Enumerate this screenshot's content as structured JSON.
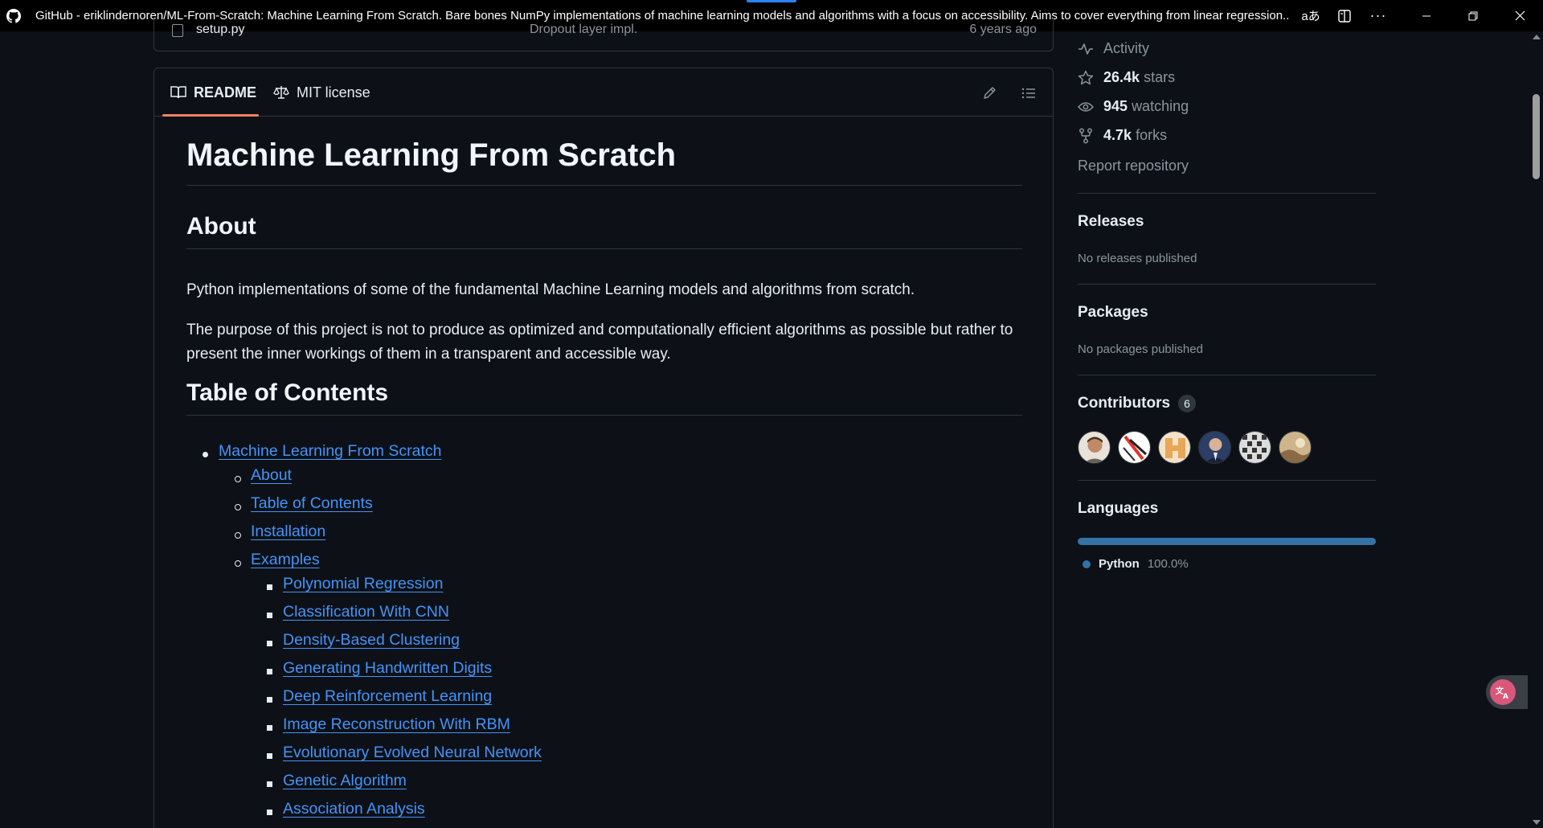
{
  "window": {
    "title": "GitHub - eriklindernoren/ML-From-Scratch: Machine Learning From Scratch. Bare bones NumPy implementations of machine learning models and algorithms with a focus on accessibility. Aims to cover everything from linear regression...",
    "read_aloud_glyph": "aあ"
  },
  "file_row": {
    "name": "setup.py",
    "message": "Dropout layer impl.",
    "time": "6 years ago"
  },
  "readme_tabs": {
    "readme": "README",
    "license": "MIT license"
  },
  "readme": {
    "title": "Machine Learning From Scratch",
    "about_heading": "About",
    "about_p1": "Python implementations of some of the fundamental Machine Learning models and algorithms from scratch.",
    "about_p2": "The purpose of this project is not to produce as optimized and computationally efficient algorithms as possible but rather to present the inner workings of them in a transparent and accessible way.",
    "toc_heading": "Table of Contents",
    "toc": {
      "root": "Machine Learning From Scratch",
      "level2": [
        "About",
        "Table of Contents",
        "Installation",
        "Examples"
      ],
      "examples": [
        "Polynomial Regression",
        "Classification With CNN",
        "Density-Based Clustering",
        "Generating Handwritten Digits",
        "Deep Reinforcement Learning",
        "Image Reconstruction With RBM",
        "Evolutionary Evolved Neural Network",
        "Genetic Algorithm",
        "Association Analysis"
      ]
    }
  },
  "sidebar": {
    "activity": "Activity",
    "stars_count": "26.4k",
    "stars_label": "stars",
    "watching_count": "945",
    "watching_label": "watching",
    "forks_count": "4.7k",
    "forks_label": "forks",
    "report": "Report repository",
    "releases_heading": "Releases",
    "releases_text": "No releases published",
    "packages_heading": "Packages",
    "packages_text": "No packages published",
    "contributors_heading": "Contributors",
    "contributors_count": "6",
    "languages_heading": "Languages",
    "language_name": "Python",
    "language_pct": "100.0%",
    "language_share": 1.0
  },
  "colors": {
    "background": "#0d1117",
    "link": "#4493f8",
    "tab_underline": "#f78166",
    "python": "#3572a5"
  }
}
